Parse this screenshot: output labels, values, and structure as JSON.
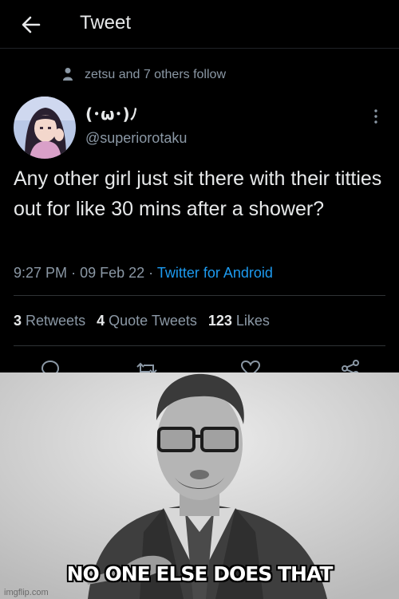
{
  "header": {
    "title": "Tweet"
  },
  "social_context": "zetsu and 7 others follow",
  "author": {
    "display_name": "(･ω･)ﾉ",
    "handle": "@superiorotaku"
  },
  "tweet": {
    "text": "Any other girl just sit there with their titties out for like 30 mins after a shower?",
    "time": "9:27 PM",
    "date": "09 Feb 22",
    "separator": "·",
    "source": "Twitter for Android"
  },
  "stats": {
    "retweets_count": "3",
    "retweets_label": "Retweets",
    "quotes_count": "4",
    "quotes_label": "Quote Tweets",
    "likes_count": "123",
    "likes_label": "Likes"
  },
  "icons": {
    "back": "arrow-left-icon",
    "person": "person-icon",
    "more": "more-vertical-icon",
    "reply": "reply-icon",
    "retweet": "retweet-icon",
    "like": "heart-icon",
    "share": "share-icon"
  },
  "colors": {
    "background": "#000000",
    "text": "#e7e9ea",
    "muted": "#8b98a5",
    "link": "#1d9bf0"
  },
  "meme": {
    "caption": "NO ONE ELSE DOES THAT",
    "watermark": "imgflip.com"
  }
}
